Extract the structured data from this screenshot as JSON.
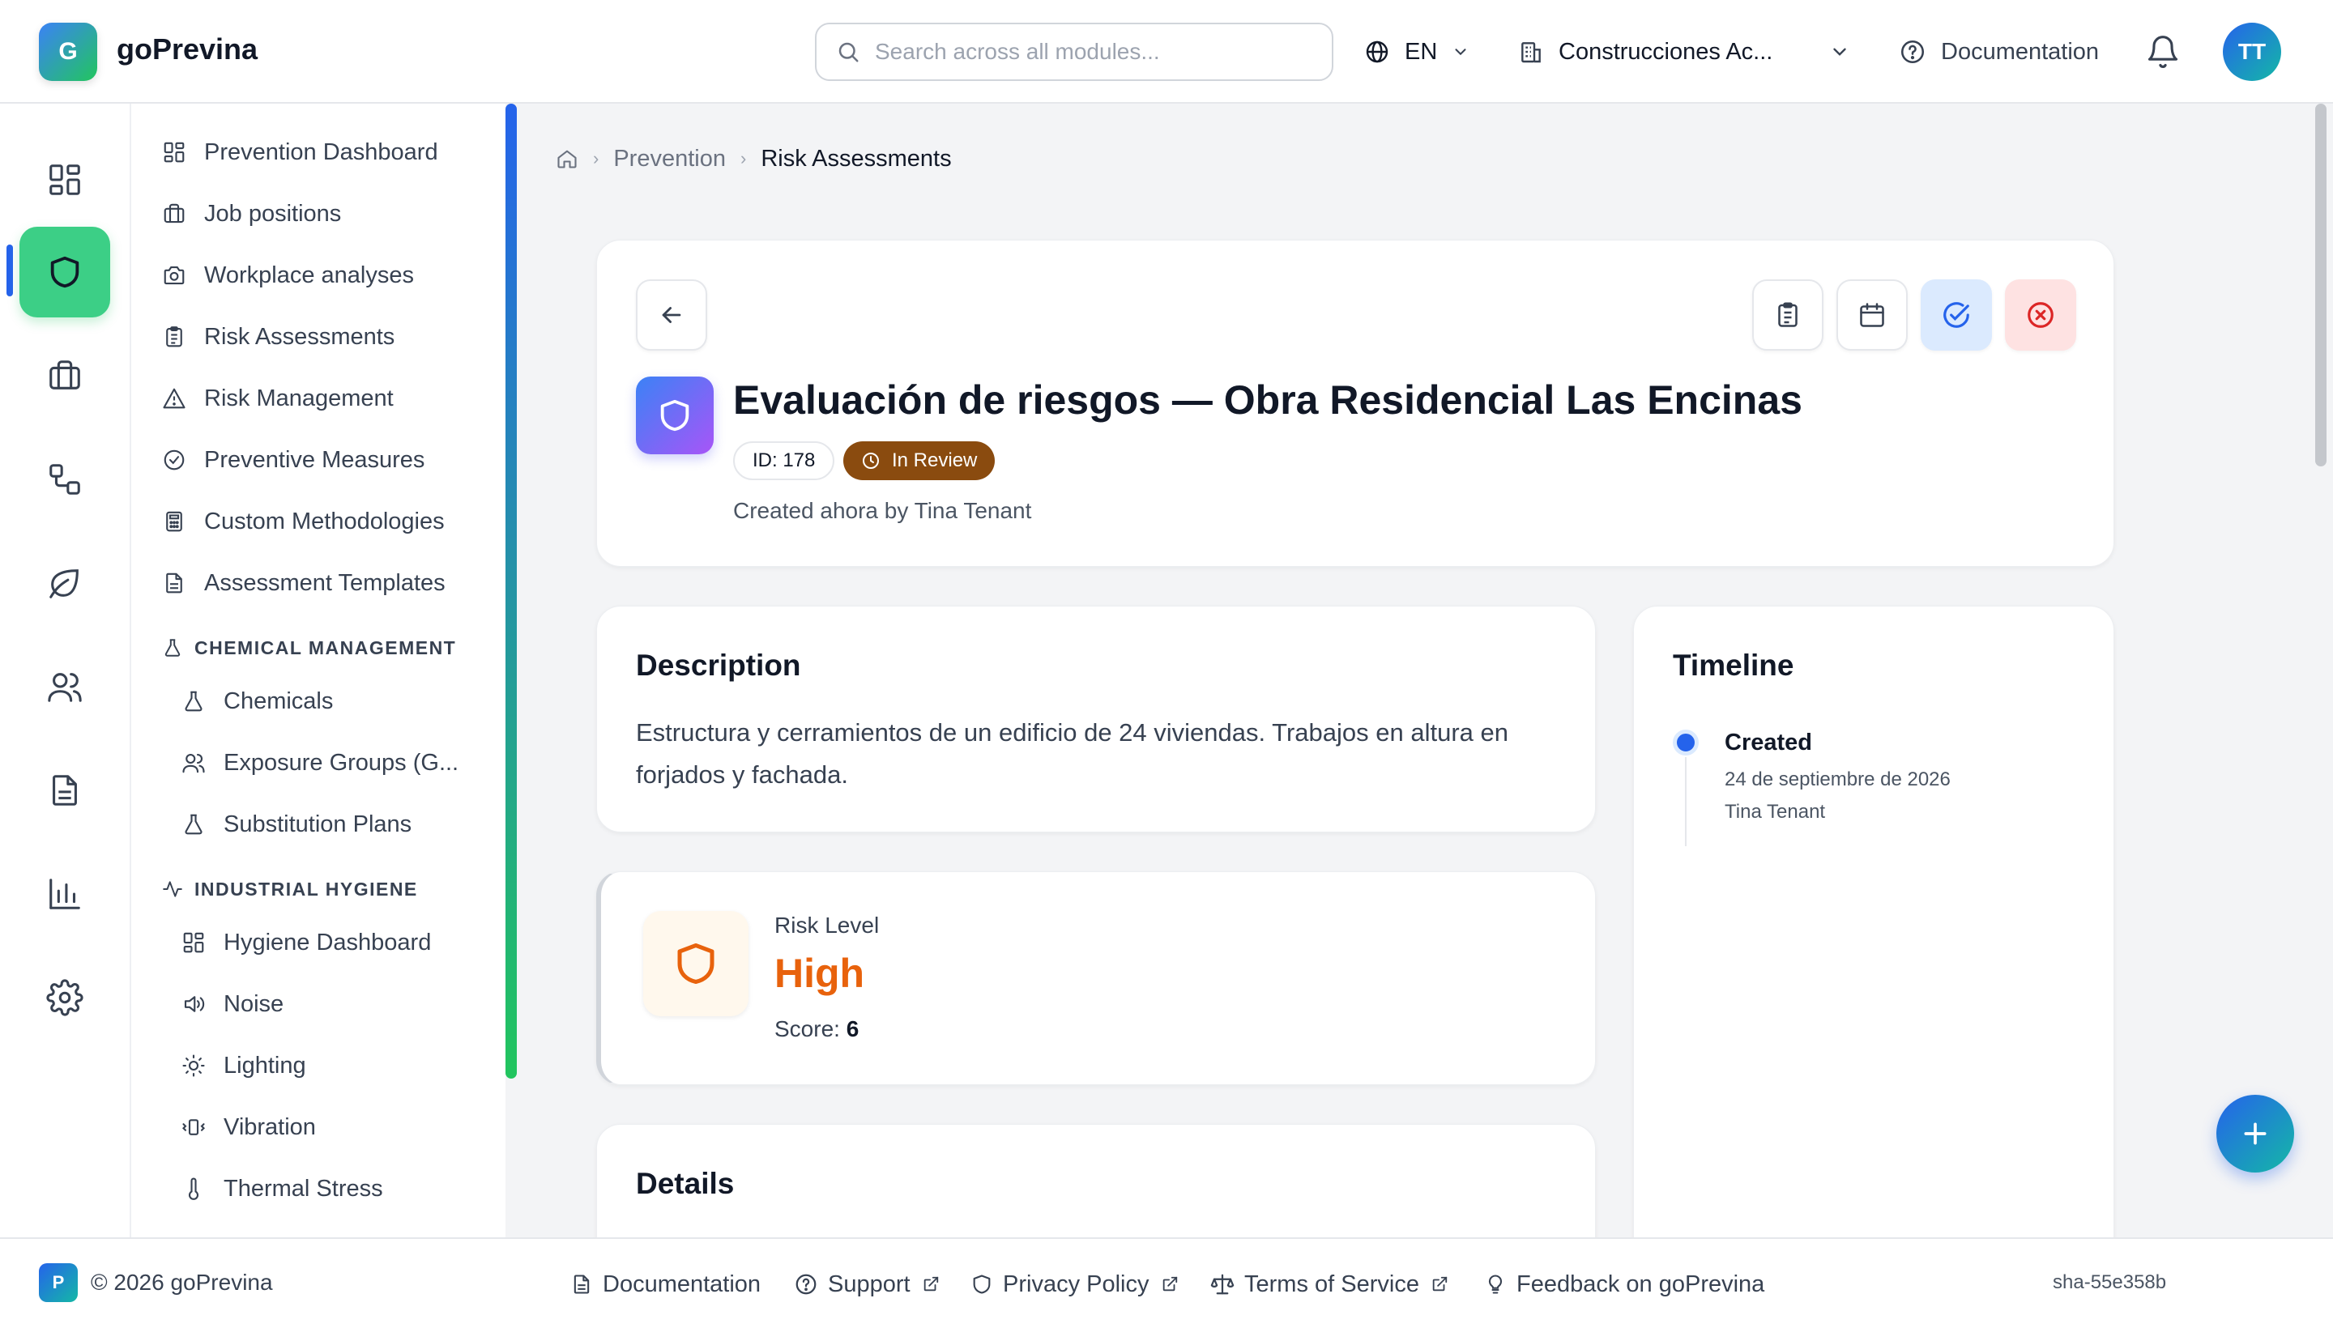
{
  "header": {
    "logo_letter": "G",
    "app_name": "goPrevina",
    "search_placeholder": "Search across all modules...",
    "language": "EN",
    "company": "Construcciones Ac...",
    "documentation": "Documentation",
    "user_initials": "TT"
  },
  "sidebar": {
    "items": [
      {
        "label": "Prevention Dashboard",
        "icon": "dashboard-icon"
      },
      {
        "label": "Job positions",
        "icon": "briefcase-icon"
      },
      {
        "label": "Workplace analyses",
        "icon": "camera-icon"
      },
      {
        "label": "Risk Assessments",
        "icon": "clipboard-icon"
      },
      {
        "label": "Risk Management",
        "icon": "warning-icon"
      },
      {
        "label": "Preventive Measures",
        "icon": "check-circle-icon"
      },
      {
        "label": "Custom Methodologies",
        "icon": "calculator-icon"
      },
      {
        "label": "Assessment Templates",
        "icon": "document-icon"
      }
    ],
    "section_chemical": "CHEMICAL MANAGEMENT",
    "chemical_items": [
      {
        "label": "Chemicals",
        "icon": "flask-icon"
      },
      {
        "label": "Exposure Groups (G...",
        "icon": "users-icon"
      },
      {
        "label": "Substitution Plans",
        "icon": "flask-icon"
      }
    ],
    "section_hygiene": "INDUSTRIAL HYGIENE",
    "hygiene_items": [
      {
        "label": "Hygiene Dashboard",
        "icon": "dashboard-icon"
      },
      {
        "label": "Noise",
        "icon": "speaker-icon"
      },
      {
        "label": "Lighting",
        "icon": "sun-icon"
      },
      {
        "label": "Vibration",
        "icon": "vibration-icon"
      },
      {
        "label": "Thermal Stress",
        "icon": "thermometer-icon"
      }
    ]
  },
  "breadcrumb": {
    "section": "Prevention",
    "current": "Risk Assessments"
  },
  "assessment": {
    "title": "Evaluación de riesgos — Obra Residencial Las Encinas",
    "id_label": "ID: 178",
    "status": "In Review",
    "created": "Created ahora by Tina Tenant"
  },
  "description": {
    "title": "Description",
    "text": "Estructura y cerramientos de un edificio de 24 viviendas. Trabajos en altura en forjados y fachada."
  },
  "risk": {
    "label": "Risk Level",
    "value": "High",
    "score_label": "Score:",
    "score": "6"
  },
  "details": {
    "title": "Details"
  },
  "timeline": {
    "title": "Timeline",
    "events": [
      {
        "title": "Created",
        "date": "24 de septiembre de 2026",
        "user": "Tina Tenant"
      }
    ]
  },
  "footer": {
    "logo_letter": "P",
    "copyright": "© 2026 goPrevina",
    "links": [
      "Documentation",
      "Support",
      "Privacy Policy",
      "Terms of Service",
      "Feedback on goPrevina"
    ],
    "version": "sha-55e358b"
  },
  "colors": {
    "accent": "#2563eb",
    "active_rail": "#3ccf86",
    "status_in_review": "#8a4b0f",
    "risk_high": "#e8620c"
  }
}
